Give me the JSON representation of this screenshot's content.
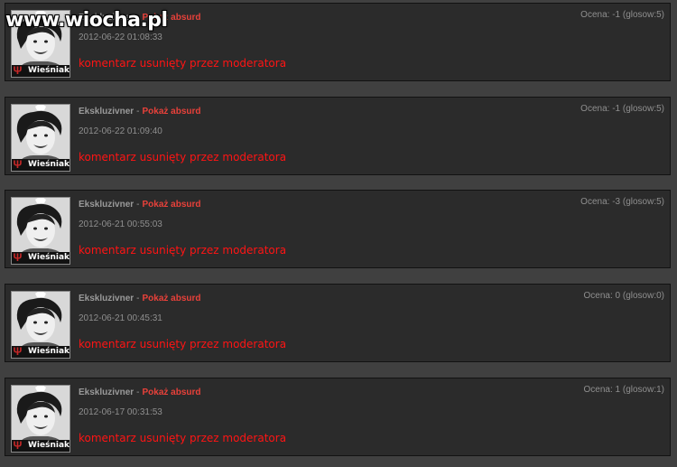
{
  "watermark": "www.wiocha.pl",
  "colors": {
    "background": "#404040",
    "card": "#2b2b2b",
    "accent": "#e8413a",
    "removed": "#ff1414"
  },
  "comments": [
    {
      "author": "Ekskluzivner",
      "separator": "-",
      "absurd_link": "Pokaż absurd",
      "date": "2012-06-22 01:08:33",
      "score": "Ocena: -1 (glosow:5)",
      "text": "komentarz usunięty przez moderatora",
      "rank": "Wieśniak",
      "avatar_icon": "user-avatar"
    },
    {
      "author": "Ekskluzivner",
      "separator": "-",
      "absurd_link": "Pokaż absurd",
      "date": "2012-06-22 01:09:40",
      "score": "Ocena: -1 (glosow:5)",
      "text": "komentarz usunięty przez moderatora",
      "rank": "Wieśniak",
      "avatar_icon": "user-avatar"
    },
    {
      "author": "Ekskluzivner",
      "separator": "-",
      "absurd_link": "Pokaż absurd",
      "date": "2012-06-21 00:55:03",
      "score": "Ocena: -3 (glosow:5)",
      "text": "komentarz usunięty przez moderatora",
      "rank": "Wieśniak",
      "avatar_icon": "user-avatar"
    },
    {
      "author": "Ekskluzivner",
      "separator": "-",
      "absurd_link": "Pokaż absurd",
      "date": "2012-06-21 00:45:31",
      "score": "Ocena: 0 (glosow:0)",
      "text": "komentarz usunięty przez moderatora",
      "rank": "Wieśniak",
      "avatar_icon": "user-avatar"
    },
    {
      "author": "Ekskluzivner",
      "separator": "-",
      "absurd_link": "Pokaż absurd",
      "date": "2012-06-17 00:31:53",
      "score": "Ocena: 1 (glosow:1)",
      "text": "komentarz usunięty przez moderatora",
      "rank": "Wieśniak",
      "avatar_icon": "user-avatar"
    }
  ]
}
